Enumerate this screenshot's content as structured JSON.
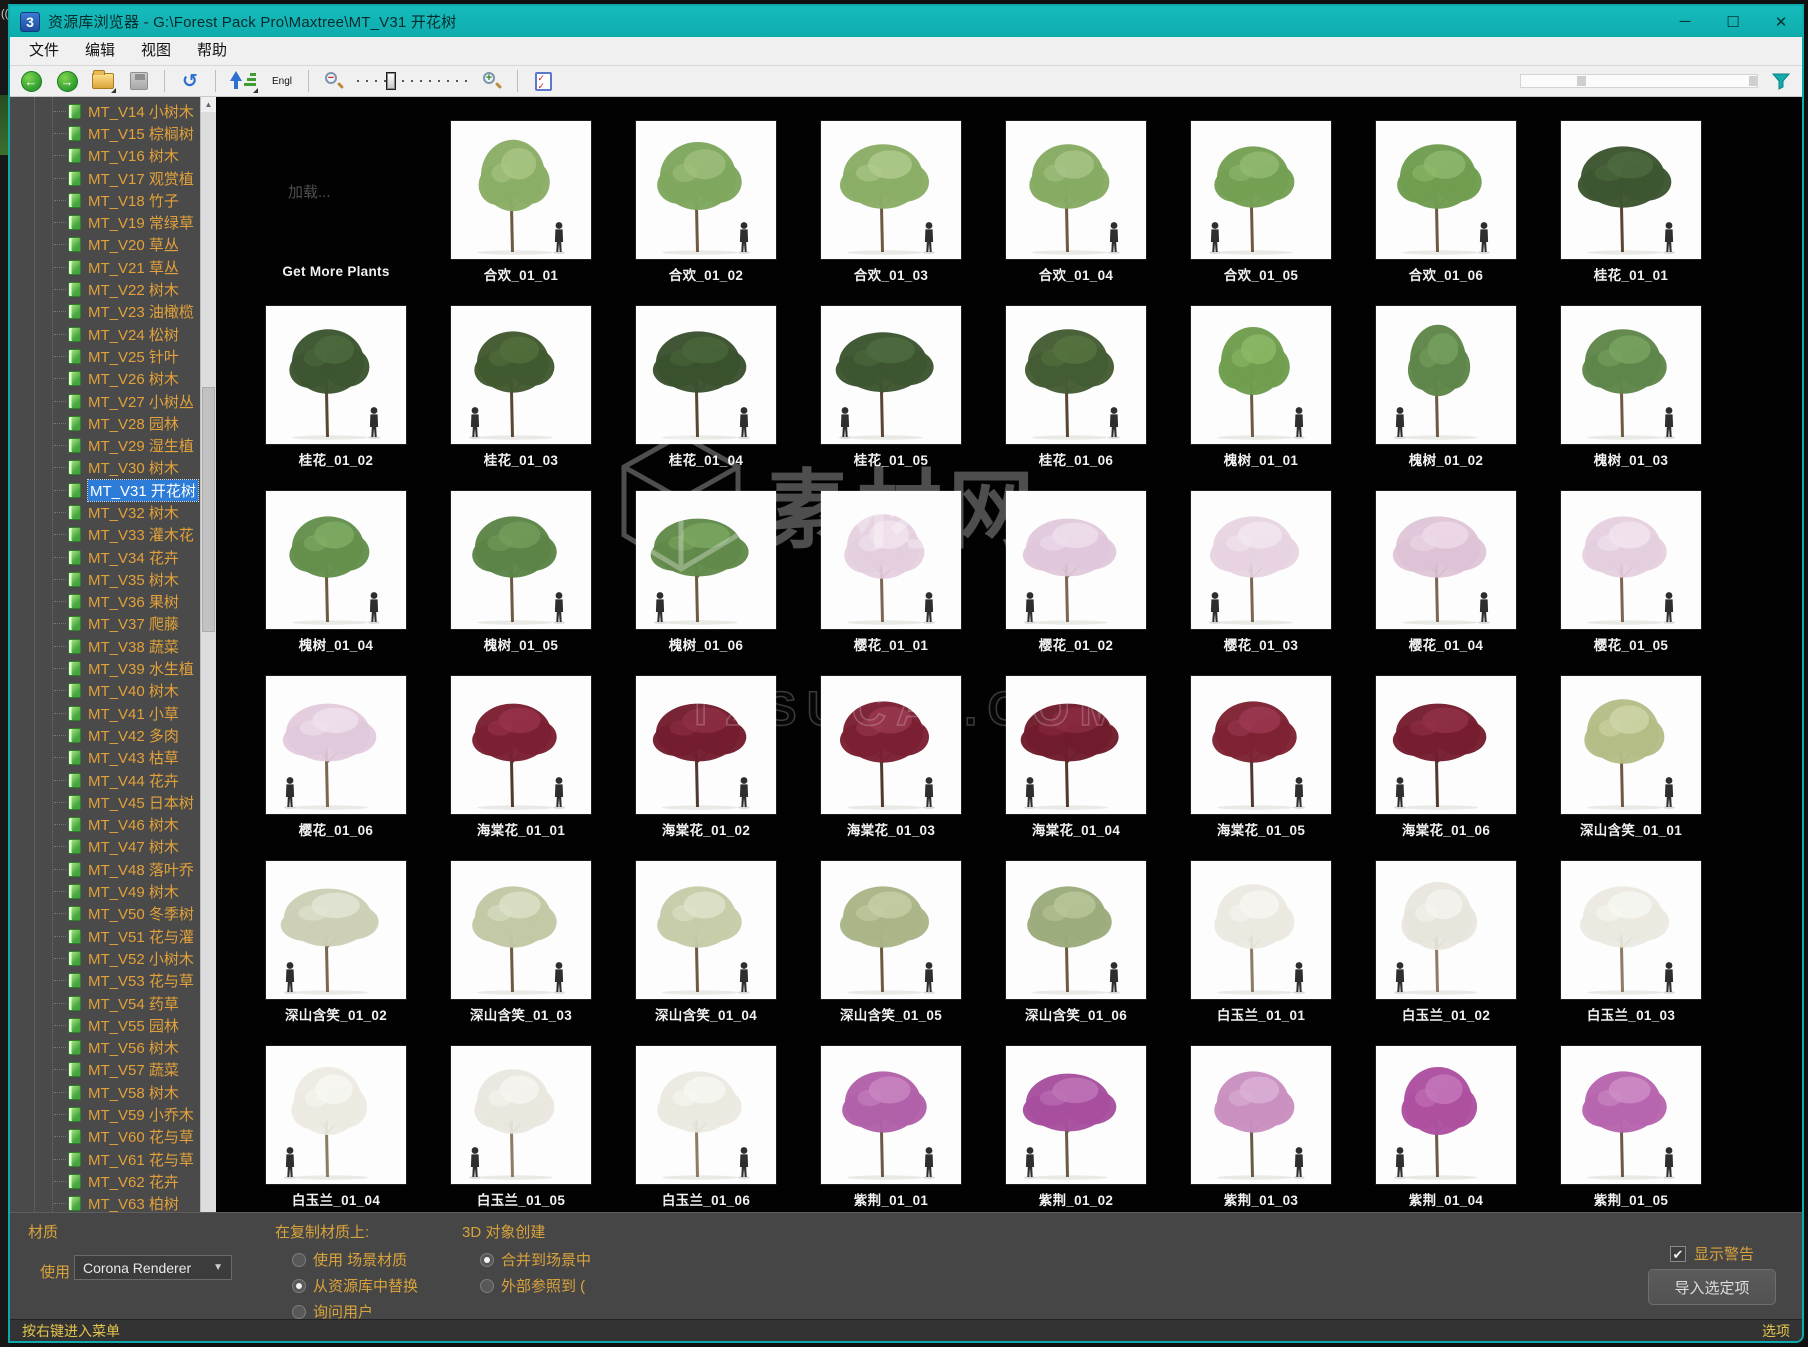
{
  "window": {
    "title": "资源库浏览器 - G:\\Forest Pack Pro\\Maxtree\\MT_V31 开花树",
    "app_icon": "3ds-max-icon",
    "controls": {
      "minimize": "─",
      "maximize": "☐",
      "close": "✕"
    }
  },
  "menu": {
    "items": [
      "文件",
      "编辑",
      "视图",
      "帮助"
    ]
  },
  "toolbar": {
    "sort_label": "Engl",
    "icons": [
      "back",
      "forward",
      "open-folder",
      "save",
      "refresh",
      "sort-ascending",
      "zoom-out",
      "zoom-slider",
      "zoom-in",
      "display-options",
      "filter"
    ]
  },
  "sidebar": {
    "items": [
      {
        "label": "MT_V14 小树木",
        "selected": false
      },
      {
        "label": "MT_V15 棕榈树",
        "selected": false
      },
      {
        "label": "MT_V16 树木",
        "selected": false
      },
      {
        "label": "MT_V17 观赏植",
        "selected": false
      },
      {
        "label": "MT_V18 竹子",
        "selected": false
      },
      {
        "label": "MT_V19 常绿草",
        "selected": false
      },
      {
        "label": "MT_V20 草丛",
        "selected": false
      },
      {
        "label": "MT_V21 草丛",
        "selected": false
      },
      {
        "label": "MT_V22 树木",
        "selected": false
      },
      {
        "label": "MT_V23 油橄榄",
        "selected": false
      },
      {
        "label": "MT_V24 松树",
        "selected": false
      },
      {
        "label": "MT_V25 针叶",
        "selected": false
      },
      {
        "label": "MT_V26 树木",
        "selected": false
      },
      {
        "label": "MT_V27 小树丛",
        "selected": false
      },
      {
        "label": "MT_V28 园林",
        "selected": false
      },
      {
        "label": "MT_V29 湿生植",
        "selected": false
      },
      {
        "label": "MT_V30 树木",
        "selected": false
      },
      {
        "label": "MT_V31 开花树",
        "selected": true
      },
      {
        "label": "MT_V32 树木",
        "selected": false
      },
      {
        "label": "MT_V33 灌木花",
        "selected": false
      },
      {
        "label": "MT_V34 花卉",
        "selected": false
      },
      {
        "label": "MT_V35 树木",
        "selected": false
      },
      {
        "label": "MT_V36 果树",
        "selected": false
      },
      {
        "label": "MT_V37 爬藤",
        "selected": false
      },
      {
        "label": "MT_V38 蔬菜",
        "selected": false
      },
      {
        "label": "MT_V39 水生植",
        "selected": false
      },
      {
        "label": "MT_V40 树木",
        "selected": false
      },
      {
        "label": "MT_V41 小草",
        "selected": false
      },
      {
        "label": "MT_V42 多肉",
        "selected": false
      },
      {
        "label": "MT_V43 枯草",
        "selected": false
      },
      {
        "label": "MT_V44 花卉",
        "selected": false
      },
      {
        "label": "MT_V45 日本树",
        "selected": false
      },
      {
        "label": "MT_V46 树木",
        "selected": false
      },
      {
        "label": "MT_V47 树木",
        "selected": false
      },
      {
        "label": "MT_V48 落叶乔",
        "selected": false
      },
      {
        "label": "MT_V49 树木",
        "selected": false
      },
      {
        "label": "MT_V50 冬季树",
        "selected": false
      },
      {
        "label": "MT_V51 花与灌",
        "selected": false
      },
      {
        "label": "MT_V52 小树木",
        "selected": false
      },
      {
        "label": "MT_V53 花与草",
        "selected": false
      },
      {
        "label": "MT_V54 药草",
        "selected": false
      },
      {
        "label": "MT_V55 园林",
        "selected": false
      },
      {
        "label": "MT_V56 树木",
        "selected": false
      },
      {
        "label": "MT_V57 蔬菜",
        "selected": false
      },
      {
        "label": "MT_V58 树木",
        "selected": false
      },
      {
        "label": "MT_V59 小乔木",
        "selected": false
      },
      {
        "label": "MT_V60 花与草",
        "selected": false
      },
      {
        "label": "MT_V61 花与草",
        "selected": false
      },
      {
        "label": "MT_V62 花卉",
        "selected": false
      },
      {
        "label": "MT_V63 柏树",
        "selected": false
      }
    ]
  },
  "grid": {
    "loading_text": "加载...",
    "items": [
      {
        "label": "Get More Plants",
        "type": "loading"
      },
      {
        "label": "合欢_01_01",
        "c": "#8aad66",
        "c2": "#aac684",
        "w": 0.8,
        "h": 1.05,
        "f": "r"
      },
      {
        "label": "合欢_01_02",
        "c": "#7fa75e",
        "c2": "#a0bf7c",
        "w": 0.95,
        "h": 1.0,
        "f": "r"
      },
      {
        "label": "合欢_01_03",
        "c": "#8aad66",
        "c2": "#b2cc8e",
        "w": 1.0,
        "h": 0.95,
        "f": "r"
      },
      {
        "label": "合欢_01_04",
        "c": "#86aa62",
        "c2": "#a8c486",
        "w": 0.9,
        "h": 0.95,
        "f": "r"
      },
      {
        "label": "合欢_01_05",
        "c": "#74a054",
        "c2": "#94ba72",
        "w": 0.9,
        "h": 0.9,
        "f": "l"
      },
      {
        "label": "合欢_01_06",
        "c": "#6f9d50",
        "c2": "#8fb96e",
        "w": 0.95,
        "h": 0.95,
        "f": "r"
      },
      {
        "label": "桂花_01_01",
        "c": "#3d5531",
        "c2": "#4d6b3e",
        "tc": "#5a4733",
        "w": 1.05,
        "h": 0.9,
        "f": "r"
      },
      {
        "label": "桂花_01_02",
        "c": "#3d5531",
        "c2": "#4d6b3e",
        "tc": "#5a4733",
        "w": 0.9,
        "h": 0.95,
        "f": "r"
      },
      {
        "label": "桂花_01_03",
        "c": "#41592f",
        "c2": "#536f3d",
        "tc": "#5a4733",
        "w": 0.9,
        "h": 0.9,
        "f": "l"
      },
      {
        "label": "桂花_01_04",
        "c": "#3a512e",
        "c2": "#4a663a",
        "tc": "#5a4733",
        "w": 1.05,
        "h": 0.9,
        "f": "r"
      },
      {
        "label": "桂花_01_05",
        "c": "#3d5531",
        "c2": "#4f6c40",
        "tc": "#5a4733",
        "w": 1.1,
        "h": 0.88,
        "f": "l"
      },
      {
        "label": "桂花_01_06",
        "c": "#445c33",
        "c2": "#567440",
        "tc": "#5a4733",
        "w": 1.0,
        "h": 0.95,
        "f": "r"
      },
      {
        "label": "槐树_01_01",
        "c": "#6f9d4e",
        "c2": "#8cba67",
        "w": 0.8,
        "h": 1.0,
        "f": "r"
      },
      {
        "label": "槐树_01_02",
        "c": "#5f864a",
        "c2": "#76a05e",
        "w": 0.7,
        "h": 1.05,
        "f": "l"
      },
      {
        "label": "槐树_01_03",
        "c": "#5f864a",
        "c2": "#79a460",
        "w": 0.95,
        "h": 0.95,
        "f": "r"
      },
      {
        "label": "槐树_01_04",
        "c": "#64904c",
        "c2": "#7fae64",
        "w": 0.9,
        "h": 0.9,
        "f": "r"
      },
      {
        "label": "槐树_01_05",
        "c": "#5c8447",
        "c2": "#749e5b",
        "w": 0.95,
        "h": 0.9,
        "f": "r"
      },
      {
        "label": "槐树_01_06",
        "c": "#618a4a",
        "c2": "#7ba860",
        "w": 1.1,
        "h": 0.85,
        "f": "l"
      },
      {
        "label": "樱花_01_01",
        "c": "#e4cede",
        "c2": "#f1e3ee",
        "tc": "#7c6652",
        "w": 0.9,
        "h": 0.95,
        "f": "r",
        "sparse": true
      },
      {
        "label": "樱花_01_02",
        "c": "#e0c7da",
        "c2": "#efdfeb",
        "tc": "#7c6652",
        "w": 1.05,
        "h": 0.85,
        "f": "l",
        "sparse": true
      },
      {
        "label": "樱花_01_03",
        "c": "#e6d2e1",
        "c2": "#f3e7f0",
        "tc": "#7c6652",
        "w": 1.0,
        "h": 0.9,
        "f": "l",
        "sparse": true
      },
      {
        "label": "樱花_01_04",
        "c": "#ddc2d6",
        "c2": "#eddbe8",
        "tc": "#7c6652",
        "w": 1.05,
        "h": 0.9,
        "f": "r",
        "sparse": true
      },
      {
        "label": "樱花_01_05",
        "c": "#e4cede",
        "c2": "#f2e5ef",
        "tc": "#7c6652",
        "w": 0.95,
        "h": 0.9,
        "f": "r",
        "sparse": true
      },
      {
        "label": "樱花_01_06",
        "c": "#e1c9db",
        "c2": "#f0e1ec",
        "tc": "#7c6652",
        "w": 1.05,
        "h": 0.85,
        "f": "l",
        "sparse": true
      },
      {
        "label": "海棠花_01_01",
        "c": "#7b2033",
        "c2": "#99334c",
        "tc": "#4f3a2d",
        "w": 0.95,
        "h": 0.85,
        "f": "r"
      },
      {
        "label": "海棠花_01_02",
        "c": "#731d2e",
        "c2": "#8f2f45",
        "tc": "#4f3a2d",
        "w": 1.05,
        "h": 0.85,
        "f": "r"
      },
      {
        "label": "海棠花_01_03",
        "c": "#7b2033",
        "c2": "#9a3850",
        "tc": "#4f3a2d",
        "w": 1.0,
        "h": 0.9,
        "f": "r"
      },
      {
        "label": "海棠花_01_04",
        "c": "#6f1c2c",
        "c2": "#8c2c42",
        "tc": "#4f3a2d",
        "w": 1.1,
        "h": 0.85,
        "f": "l"
      },
      {
        "label": "海棠花_01_05",
        "c": "#7e2234",
        "c2": "#9d3a52",
        "tc": "#4f3a2d",
        "w": 0.95,
        "h": 0.9,
        "f": "r"
      },
      {
        "label": "海棠花_01_06",
        "c": "#761e30",
        "c2": "#933148",
        "tc": "#4f3a2d",
        "w": 1.05,
        "h": 0.85,
        "f": "l"
      },
      {
        "label": "深山含笑_01_01",
        "c": "#b5bd86",
        "c2": "#d0d6a8",
        "w": 0.9,
        "h": 0.95,
        "f": "r"
      },
      {
        "label": "深山含笑_01_02",
        "c": "#ccd0b6",
        "c2": "#e4e6d6",
        "tc": "#7c6652",
        "w": 1.1,
        "h": 0.85,
        "f": "l"
      },
      {
        "label": "深山含笑_01_03",
        "c": "#c2c8a4",
        "c2": "#dde1c8",
        "w": 0.95,
        "h": 0.9,
        "f": "r"
      },
      {
        "label": "深山含笑_01_04",
        "c": "#c6cba8",
        "c2": "#e0e3cc",
        "w": 0.95,
        "h": 0.9,
        "f": "r"
      },
      {
        "label": "深山含笑_01_05",
        "c": "#a9b588",
        "c2": "#c6cfa8",
        "w": 1.0,
        "h": 0.9,
        "f": "r"
      },
      {
        "label": "深山含笑_01_06",
        "c": "#9cab7c",
        "c2": "#bac79a",
        "w": 0.95,
        "h": 0.9,
        "f": "r"
      },
      {
        "label": "白玉兰_01_01",
        "c": "#eae8e0",
        "c2": "#f7f6f2",
        "tc": "#8d7c63",
        "w": 0.9,
        "h": 0.95,
        "f": "r",
        "sparse": true
      },
      {
        "label": "白玉兰_01_02",
        "c": "#e7e5dc",
        "c2": "#f5f4ef",
        "tc": "#8d7c63",
        "w": 0.85,
        "h": 1.0,
        "f": "l",
        "sparse": true
      },
      {
        "label": "白玉兰_01_03",
        "c": "#eae8e0",
        "c2": "#f8f7f3",
        "tc": "#8d7c63",
        "w": 1.0,
        "h": 0.9,
        "f": "r",
        "sparse": true
      },
      {
        "label": "白玉兰_01_04",
        "c": "#ece9e1",
        "c2": "#f8f7f3",
        "tc": "#8d7c63",
        "w": 0.85,
        "h": 1.0,
        "f": "l",
        "sparse": true
      },
      {
        "label": "白玉兰_01_05",
        "c": "#e8e6dd",
        "c2": "#f6f5f0",
        "tc": "#8d7c63",
        "w": 0.9,
        "h": 0.95,
        "f": "l",
        "sparse": true
      },
      {
        "label": "白玉兰_01_06",
        "c": "#eae8e0",
        "c2": "#f8f7f3",
        "tc": "#8d7c63",
        "w": 0.95,
        "h": 0.9,
        "f": "r",
        "sparse": true
      },
      {
        "label": "紫荆_01_01",
        "c": "#b161a8",
        "c2": "#c987c2",
        "tc": "#6b5a46",
        "w": 0.95,
        "h": 0.9,
        "f": "r"
      },
      {
        "label": "紫荆_01_02",
        "c": "#a74f9e",
        "c2": "#c076b8",
        "tc": "#6b5a46",
        "w": 1.05,
        "h": 0.85,
        "f": "l"
      },
      {
        "label": "紫荆_01_03",
        "c": "#c88fc0",
        "c2": "#dcb2d6",
        "tc": "#6b5a46",
        "w": 0.9,
        "h": 0.9,
        "f": "r"
      },
      {
        "label": "紫荆_01_04",
        "c": "#ad4fa0",
        "c2": "#c578ba",
        "tc": "#6b5a46",
        "w": 0.85,
        "h": 1.0,
        "f": "l"
      },
      {
        "label": "紫荆_01_05",
        "c": "#b765ae",
        "c2": "#ce8ec7",
        "tc": "#6b5a46",
        "w": 0.95,
        "h": 0.9,
        "f": "r"
      }
    ]
  },
  "watermark": {
    "line1": "素材网",
    "line2": "TZSUCAI.COM"
  },
  "material_panel": {
    "title": "材质",
    "use_label": "使用",
    "renderer_value": "Corona Renderer",
    "on_duplicate_title": "在复制材质上:",
    "duplicate_options": [
      {
        "label": "使用 场景材质",
        "selected": false
      },
      {
        "label": "从资源库中替换",
        "selected": true
      },
      {
        "label": "询问用户",
        "selected": false
      }
    ],
    "creation_title": "3D 对象创建",
    "creation_options": [
      {
        "label": "合并到场景中",
        "selected": true
      },
      {
        "label": "外部参照到 (",
        "selected": false
      }
    ],
    "show_warnings": {
      "label": "显示警告",
      "checked": true
    },
    "import_button": "导入选定项"
  },
  "status_bar": {
    "left": "按右键进入菜单",
    "right": "选项"
  }
}
